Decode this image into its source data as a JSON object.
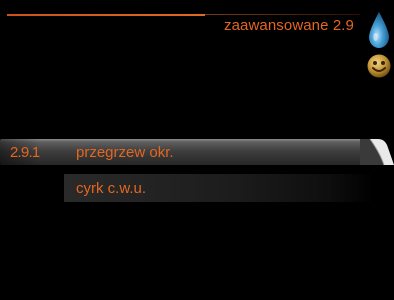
{
  "header": {
    "title": "zaawansowane 2.9"
  },
  "status_icons": [
    {
      "name": "hot-water-drop-icon",
      "color": "#4aa3d8"
    },
    {
      "name": "comfort-smiley-icon",
      "color": "#c79a3a"
    }
  ],
  "menu": {
    "items": [
      {
        "number": "2.9.1",
        "label": "przegrzew okr.",
        "selected": true
      },
      {
        "number": "",
        "label": "cyrk c.w.u.",
        "selected": false
      }
    ]
  },
  "colors": {
    "accent": "#e4661f",
    "background": "#000000",
    "selected_bar": "#4a4a4a"
  }
}
